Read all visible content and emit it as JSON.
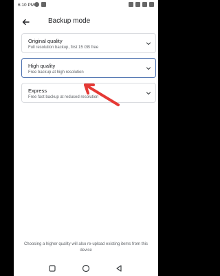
{
  "status_bar": {
    "time": "6:10 PM"
  },
  "app_bar": {
    "title": "Backup mode"
  },
  "options": [
    {
      "title": "Original quality",
      "subtitle": "Full resolution backup, first 15 GB free",
      "selected": false
    },
    {
      "title": "High quality",
      "subtitle": "Free backup at high resolution",
      "selected": true
    },
    {
      "title": "Express",
      "subtitle": "Free fast backup at reduced resolution",
      "selected": false
    }
  ],
  "footer": {
    "note": "Choosing a higher quality will also re-upload existing items from this device"
  },
  "colors": {
    "selected_border": "#4a6fae",
    "annotation_arrow": "#e53935"
  },
  "icons": {
    "back": "arrow-back-icon",
    "chevron": "chevron-down-icon",
    "nav_recents": "square-icon",
    "nav_home": "circle-icon",
    "nav_back": "triangle-icon"
  }
}
